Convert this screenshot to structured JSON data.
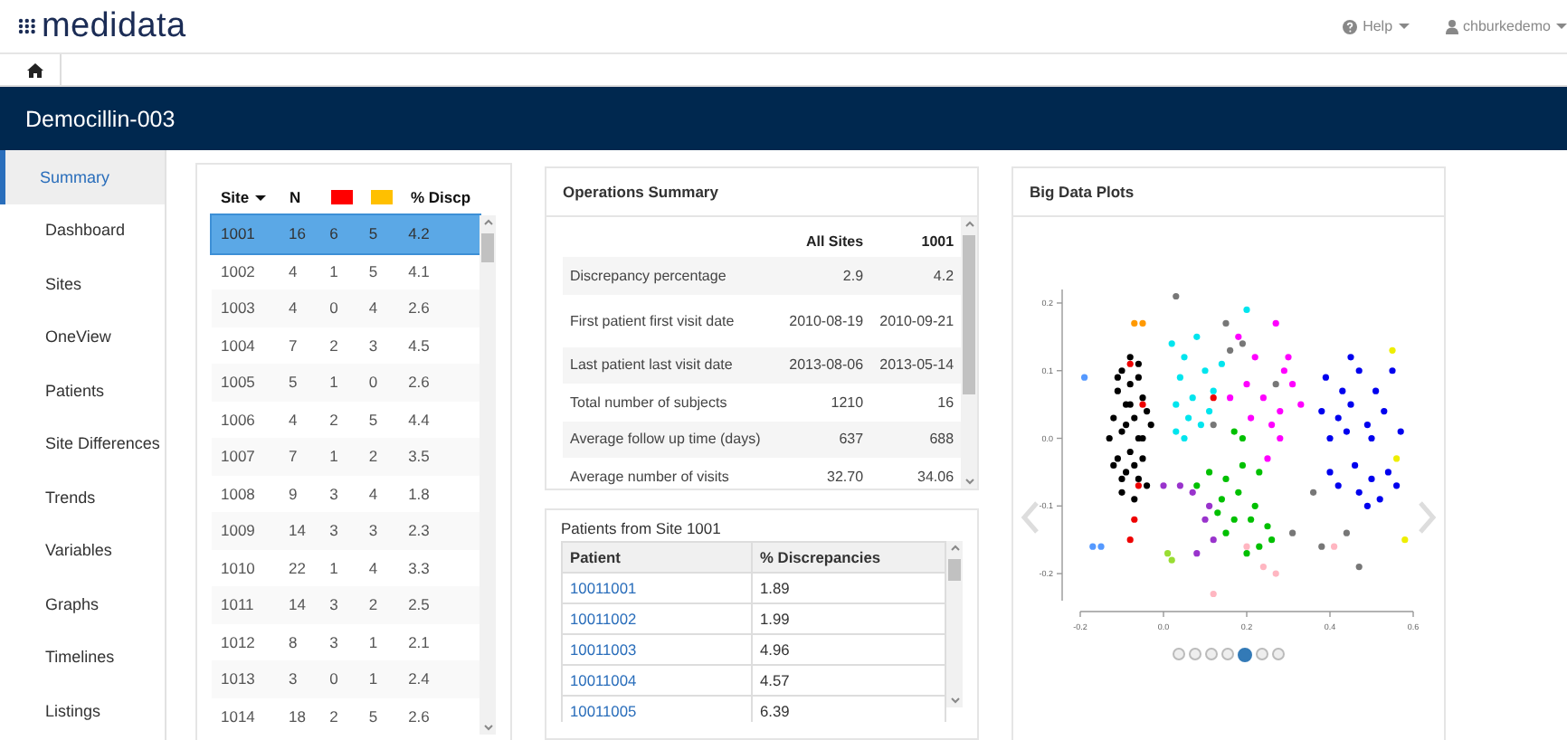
{
  "header": {
    "logo": "medidata",
    "help": "Help",
    "user": "chburkedemo"
  },
  "nav": {
    "home_selected": true
  },
  "study_title": "Democillin-003",
  "sidebar": {
    "items": [
      {
        "label": "Summary",
        "selected": true
      },
      {
        "label": "Dashboard",
        "selected": false
      },
      {
        "label": "Sites",
        "selected": false
      },
      {
        "label": "OneView",
        "selected": false
      },
      {
        "label": "Patients",
        "selected": false
      },
      {
        "label": "Site Differences",
        "selected": false
      },
      {
        "label": "Trends",
        "selected": false
      },
      {
        "label": "Variables",
        "selected": false
      },
      {
        "label": "Graphs",
        "selected": false
      },
      {
        "label": "Timelines",
        "selected": false
      },
      {
        "label": "Listings",
        "selected": false
      }
    ]
  },
  "sites_table": {
    "columns": [
      {
        "label": "Site",
        "sorted": true
      },
      {
        "label": "N",
        "sorted": false
      },
      {
        "color": "#ff0000"
      },
      {
        "color": "#ffc000"
      },
      {
        "label": "% Discp",
        "sorted": false
      }
    ],
    "rows": [
      {
        "cells": [
          "1001",
          "16",
          "6",
          "5",
          "4.2"
        ],
        "selected": true
      },
      {
        "cells": [
          "1002",
          "4",
          "1",
          "5",
          "4.1"
        ],
        "selected": false
      },
      {
        "cells": [
          "1003",
          "4",
          "0",
          "4",
          "2.6"
        ],
        "selected": false
      },
      {
        "cells": [
          "1004",
          "7",
          "2",
          "3",
          "4.5"
        ],
        "selected": false
      },
      {
        "cells": [
          "1005",
          "5",
          "1",
          "0",
          "2.6"
        ],
        "selected": false
      },
      {
        "cells": [
          "1006",
          "4",
          "2",
          "5",
          "4.4"
        ],
        "selected": false
      },
      {
        "cells": [
          "1007",
          "7",
          "1",
          "2",
          "3.5"
        ],
        "selected": false
      },
      {
        "cells": [
          "1008",
          "9",
          "3",
          "4",
          "1.8"
        ],
        "selected": false
      },
      {
        "cells": [
          "1009",
          "14",
          "3",
          "3",
          "2.3"
        ],
        "selected": false
      },
      {
        "cells": [
          "1010",
          "22",
          "1",
          "4",
          "3.3"
        ],
        "selected": false
      },
      {
        "cells": [
          "1011",
          "14",
          "3",
          "2",
          "2.5"
        ],
        "selected": false
      },
      {
        "cells": [
          "1012",
          "8",
          "3",
          "1",
          "2.1"
        ],
        "selected": false
      },
      {
        "cells": [
          "1013",
          "3",
          "0",
          "1",
          "2.4"
        ],
        "selected": false
      },
      {
        "cells": [
          "1014",
          "18",
          "2",
          "5",
          "2.6"
        ],
        "selected": false
      }
    ]
  },
  "operations_summary": {
    "title": "Operations Summary",
    "columns": [
      "All Sites",
      "1001"
    ],
    "rows": [
      {
        "label": "Discrepancy percentage",
        "values": [
          "2.9",
          "4.2"
        ]
      },
      {
        "label": "First patient first visit date",
        "values": [
          "2010-08-19",
          "2010-09-21"
        ]
      },
      {
        "label": "Last patient last visit date",
        "values": [
          "2013-08-06",
          "2013-05-14"
        ]
      },
      {
        "label": "Total number of subjects",
        "values": [
          "1210",
          "16"
        ]
      },
      {
        "label": "Average follow up time (days)",
        "values": [
          "637",
          "688"
        ]
      },
      {
        "label": "Average number of visits",
        "values": [
          "32.70",
          "34.06"
        ]
      }
    ]
  },
  "patients_panel": {
    "title": "Patients from Site 1001",
    "columns": [
      "Patient",
      "% Discrepancies"
    ],
    "rows": [
      {
        "patient": "10011001",
        "discrepancies": "1.89"
      },
      {
        "patient": "10011002",
        "discrepancies": "1.99"
      },
      {
        "patient": "10011003",
        "discrepancies": "4.96"
      },
      {
        "patient": "10011004",
        "discrepancies": "4.57"
      },
      {
        "patient": "10011005",
        "discrepancies": "6.39"
      }
    ]
  },
  "big_data_plots": {
    "title": "Big Data Plots",
    "carousel": [
      {
        "selected": false
      },
      {
        "selected": false
      },
      {
        "selected": false
      },
      {
        "selected": false
      },
      {
        "selected": true
      },
      {
        "selected": false
      },
      {
        "selected": false
      }
    ],
    "chart_data": {
      "type": "scatter",
      "xlim": [
        -0.2,
        0.6
      ],
      "ylim": [
        -0.24,
        0.22
      ],
      "xticks": [
        {
          "value": -0.2,
          "label": "-0.2"
        },
        {
          "value": 0,
          "label": "0.0"
        },
        {
          "value": 0.2,
          "label": "0.2"
        },
        {
          "value": 0.4,
          "label": "0.4"
        },
        {
          "value": 0.6,
          "label": "0.6"
        }
      ],
      "yticks": [
        {
          "value": 0.2,
          "label": "0.2"
        },
        {
          "value": 0.1,
          "label": "0.1"
        },
        {
          "value": 0,
          "label": "0.0"
        },
        {
          "value": -0.1,
          "label": "-0.1"
        },
        {
          "value": -0.2,
          "label": "-0.2"
        }
      ],
      "series": [
        {
          "color": "#000000",
          "x": [
            -0.1,
            -0.08,
            -0.06,
            -0.11,
            -0.09,
            -0.05,
            -0.12,
            -0.07,
            -0.03,
            -0.1,
            -0.06,
            -0.13,
            -0.04,
            -0.08,
            -0.11,
            -0.05,
            -0.09,
            -0.12,
            -0.06,
            -0.1,
            -0.07,
            -0.04,
            -0.08,
            -0.1,
            -0.06,
            -0.09,
            -0.07,
            -0.11,
            -0.05,
            -0.08
          ],
          "values": [
            0.1,
            0.12,
            0.09,
            0.07,
            0.05,
            0.06,
            0.03,
            0.03,
            0.02,
            0.01,
            0.0,
            0.0,
            0.04,
            -0.02,
            -0.03,
            -0.03,
            -0.05,
            -0.04,
            -0.06,
            -0.08,
            -0.09,
            -0.07,
            0.08,
            -0.06,
            0.11,
            0.02,
            -0.04,
            0.09,
            0.0,
            0.05
          ]
        },
        {
          "color": "#00e5ee",
          "x": [
            0.02,
            0.05,
            0.08,
            0.04,
            0.1,
            0.07,
            0.03,
            0.12,
            0.06,
            0.09,
            0.03,
            0.14,
            0.2,
            0.05,
            0.11
          ],
          "values": [
            0.14,
            0.12,
            0.15,
            0.09,
            0.1,
            0.06,
            0.05,
            0.07,
            0.03,
            0.02,
            0.01,
            0.11,
            0.19,
            0.0,
            0.04
          ]
        },
        {
          "color": "#ff00ff",
          "x": [
            0.18,
            0.22,
            0.27,
            0.29,
            0.2,
            0.24,
            0.28,
            0.31,
            0.16,
            0.26,
            0.21,
            0.3,
            0.25,
            0.28,
            0.33
          ],
          "values": [
            0.15,
            0.12,
            0.17,
            0.1,
            0.08,
            0.06,
            0.04,
            0.08,
            0.06,
            0.02,
            0.03,
            0.12,
            -0.03,
            0.0,
            0.05
          ]
        },
        {
          "color": "#00c000",
          "x": [
            0.11,
            0.15,
            0.19,
            0.23,
            0.14,
            0.18,
            0.22,
            0.13,
            0.17,
            0.21,
            0.25,
            0.15,
            0.19,
            0.17,
            0.2,
            0.23,
            0.26,
            0.08
          ],
          "values": [
            -0.05,
            -0.06,
            -0.04,
            -0.05,
            -0.09,
            -0.08,
            -0.1,
            -0.11,
            -0.12,
            -0.12,
            -0.13,
            -0.14,
            0.0,
            0.01,
            -0.17,
            -0.16,
            -0.15,
            -0.07
          ]
        },
        {
          "color": "#0000ee",
          "x": [
            0.39,
            0.43,
            0.47,
            0.51,
            0.55,
            0.42,
            0.45,
            0.49,
            0.53,
            0.57,
            0.4,
            0.44,
            0.5,
            0.38,
            0.46,
            0.5,
            0.54,
            0.42,
            0.47,
            0.52,
            0.56,
            0.4,
            0.49,
            0.45
          ],
          "values": [
            0.09,
            0.07,
            0.1,
            0.07,
            0.1,
            0.03,
            0.05,
            0.02,
            0.04,
            0.01,
            0.0,
            0.01,
            0.0,
            0.04,
            -0.04,
            -0.06,
            -0.05,
            -0.07,
            -0.08,
            -0.09,
            -0.07,
            -0.05,
            -0.1,
            0.12
          ]
        },
        {
          "color": "#9933cc",
          "x": [
            0.0,
            0.04,
            0.07,
            0.11,
            0.12,
            0.1,
            0.08
          ],
          "values": [
            -0.07,
            -0.07,
            -0.08,
            -0.1,
            -0.15,
            -0.12,
            -0.17
          ]
        },
        {
          "color": "#777777",
          "x": [
            0.03,
            0.15,
            0.19,
            0.16,
            0.27,
            0.31,
            0.36,
            0.44,
            0.47,
            0.38,
            0.12
          ],
          "values": [
            0.21,
            0.17,
            0.14,
            0.13,
            0.08,
            -0.14,
            -0.08,
            -0.14,
            -0.19,
            -0.16,
            0.02
          ]
        },
        {
          "color": "#ee0000",
          "x": [
            -0.08,
            -0.05,
            -0.06,
            -0.07,
            -0.08,
            0.12
          ],
          "values": [
            0.11,
            0.05,
            -0.07,
            -0.12,
            -0.15,
            0.06
          ]
        },
        {
          "color": "#ffb6c1",
          "x": [
            0.2,
            0.24,
            0.27,
            0.12,
            0.41
          ],
          "values": [
            -0.16,
            -0.19,
            -0.2,
            -0.23,
            -0.16
          ]
        },
        {
          "color": "#ff9900",
          "x": [
            -0.07,
            -0.05
          ],
          "values": [
            0.17,
            0.17
          ]
        },
        {
          "color": "#eeee00",
          "x": [
            0.55,
            0.56,
            0.58
          ],
          "values": [
            0.13,
            -0.03,
            -0.15
          ]
        },
        {
          "color": "#5599ff",
          "x": [
            -0.19,
            -0.17,
            -0.15
          ],
          "values": [
            0.09,
            -0.16,
            -0.16
          ]
        },
        {
          "color": "#99dd33",
          "x": [
            0.01,
            0.02
          ],
          "values": [
            -0.17,
            -0.18
          ]
        }
      ]
    }
  }
}
